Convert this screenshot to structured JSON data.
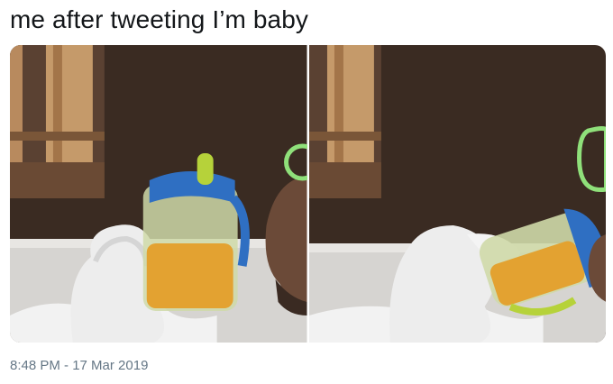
{
  "tweet": {
    "text": "me after tweeting I’m baby",
    "timestamp": "8:48 PM - 17 Mar 2019"
  },
  "media": {
    "count": 2,
    "photos": [
      {
        "subject": "person-in-bubble-bath-with-sippy-cup",
        "icon": "photo-left"
      },
      {
        "subject": "person-drinking-from-sippy-cup-in-bubble-bath",
        "icon": "photo-right"
      }
    ]
  },
  "colors": {
    "text": "#14171a",
    "secondary_text": "#657786",
    "wall": "#3b2a20",
    "window_frame": "#b88a5e",
    "tub": "#d6d4d1",
    "cup_blue": "#2f6fc2",
    "cup_juice": "#e3a231",
    "spout_green": "#b6d23a"
  }
}
